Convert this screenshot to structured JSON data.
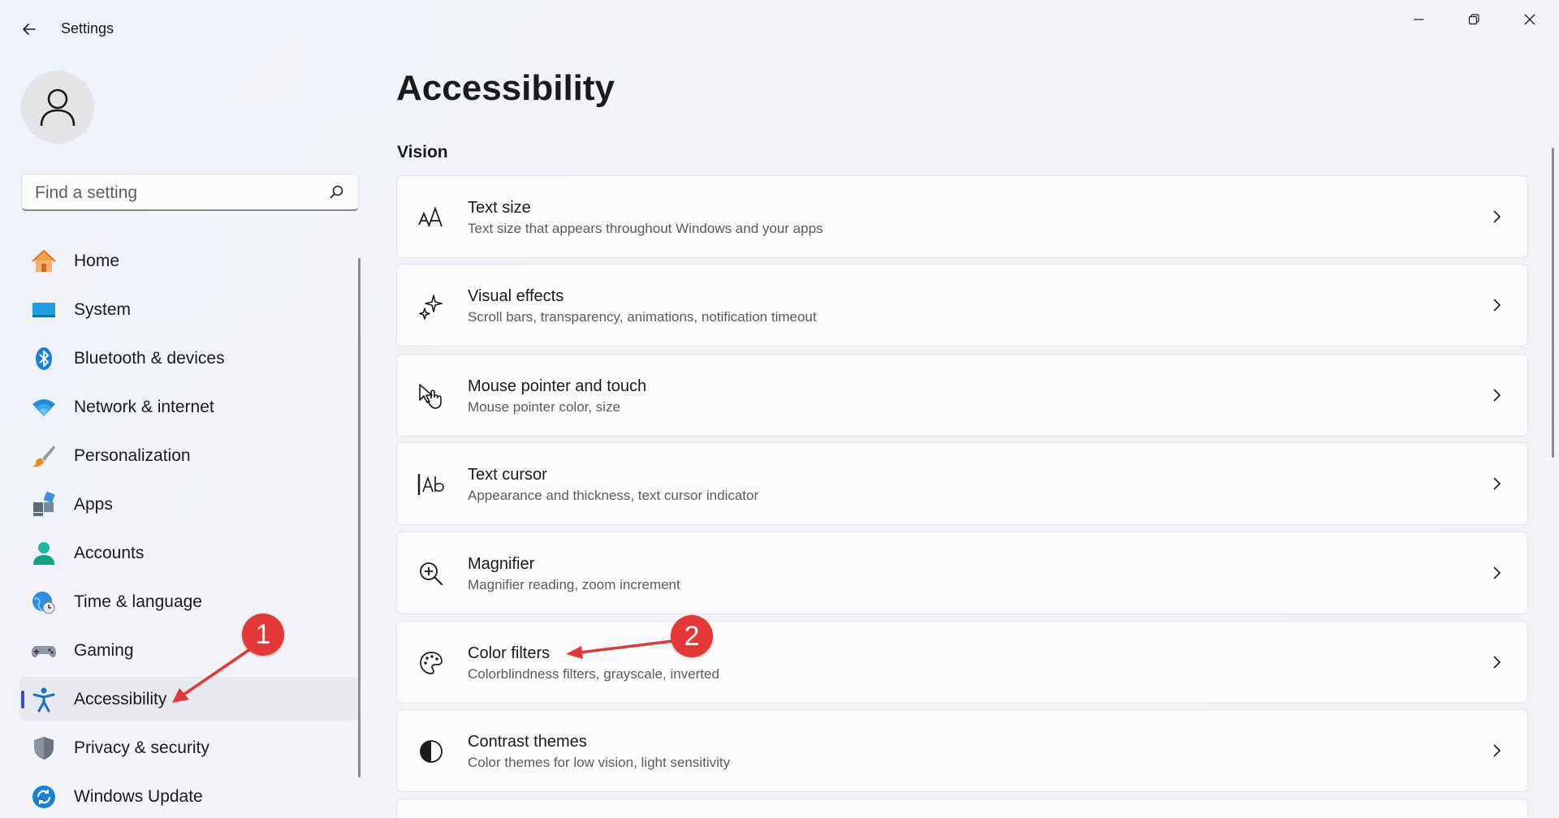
{
  "window": {
    "title": "Settings",
    "controls": [
      "minimize",
      "maximize",
      "close"
    ]
  },
  "sidebar": {
    "search_placeholder": "Find a setting",
    "items": [
      {
        "label": "Home",
        "icon": "home-icon"
      },
      {
        "label": "System",
        "icon": "system-icon"
      },
      {
        "label": "Bluetooth & devices",
        "icon": "bluetooth-icon"
      },
      {
        "label": "Network & internet",
        "icon": "wifi-icon"
      },
      {
        "label": "Personalization",
        "icon": "brush-icon"
      },
      {
        "label": "Apps",
        "icon": "apps-icon"
      },
      {
        "label": "Accounts",
        "icon": "person-icon"
      },
      {
        "label": "Time & language",
        "icon": "globe-clock-icon"
      },
      {
        "label": "Gaming",
        "icon": "gamepad-icon"
      },
      {
        "label": "Accessibility",
        "icon": "accessibility-icon",
        "selected": true
      },
      {
        "label": "Privacy & security",
        "icon": "shield-icon"
      },
      {
        "label": "Windows Update",
        "icon": "update-icon"
      }
    ]
  },
  "main": {
    "title": "Accessibility",
    "section": "Vision",
    "cards": [
      {
        "title": "Text size",
        "desc": "Text size that appears throughout Windows and your apps",
        "icon": "text-size-icon"
      },
      {
        "title": "Visual effects",
        "desc": "Scroll bars, transparency, animations, notification timeout",
        "icon": "sparkle-icon"
      },
      {
        "title": "Mouse pointer and touch",
        "desc": "Mouse pointer color, size",
        "icon": "pointer-touch-icon"
      },
      {
        "title": "Text cursor",
        "desc": "Appearance and thickness, text cursor indicator",
        "icon": "text-cursor-icon"
      },
      {
        "title": "Magnifier",
        "desc": "Magnifier reading, zoom increment",
        "icon": "magnifier-icon"
      },
      {
        "title": "Color filters",
        "desc": "Colorblindness filters, grayscale, inverted",
        "icon": "palette-icon"
      },
      {
        "title": "Contrast themes",
        "desc": "Color themes for low vision, light sensitivity",
        "icon": "contrast-icon"
      }
    ]
  },
  "annotations": [
    {
      "label": "1",
      "color": "#e43838"
    },
    {
      "label": "2",
      "color": "#e43838"
    }
  ],
  "colors": {
    "accent": "#3a4ec2",
    "annotation": "#e43838"
  }
}
